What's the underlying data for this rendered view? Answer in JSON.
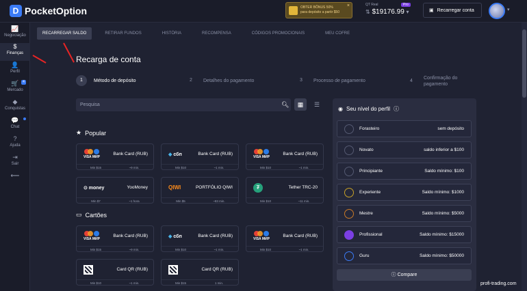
{
  "header": {
    "logo": "PocketOption",
    "bonus_line1": "OBTER BÔNUS 50%",
    "bonus_line2": "para depósito a partir $50",
    "bonus_close": "×",
    "balance_label": "QT Real",
    "balance_badge": "Pro",
    "balance": "$19176.99",
    "recharge_button": "Recarregar conta",
    "brand_color": "#3b7bf6"
  },
  "sidebar": {
    "items": [
      {
        "icon": "chart-icon",
        "glyph": "📈",
        "label": "Negociação"
      },
      {
        "icon": "dollar-icon",
        "glyph": "$",
        "label": "Finanças"
      },
      {
        "icon": "user-icon",
        "glyph": "👤",
        "label": "Perfil"
      },
      {
        "icon": "cart-icon",
        "glyph": "🛒",
        "label": "Mercado",
        "badge": "4"
      },
      {
        "icon": "diamond-icon",
        "glyph": "◆",
        "label": "Conquistas"
      },
      {
        "icon": "chat-icon",
        "glyph": "💬",
        "label": "Chat"
      },
      {
        "icon": "help-icon",
        "glyph": "?",
        "label": "Ajuda"
      },
      {
        "icon": "logout-icon",
        "glyph": "⇥",
        "label": "Sair"
      },
      {
        "icon": "collapse-icon",
        "glyph": "⟵",
        "label": ""
      }
    ]
  },
  "tabs": [
    "RECARREGAR SALDO",
    "RETIRAR FUNDOS",
    "HISTÓRIA",
    "RECOMPENSA",
    "CÓDIGOS PROMOCIONAIS",
    "MEU COFRE"
  ],
  "page_title": "Recarga de conta",
  "steps": [
    {
      "num": "1",
      "label": "Método de depósito"
    },
    {
      "num": "2",
      "label": "Detalhes do pagamento"
    },
    {
      "num": "3",
      "label": "Processo de pagamento"
    },
    {
      "num": "4",
      "label": "Confirmação do pagamento"
    }
  ],
  "search": {
    "placeholder": "Pesquisa"
  },
  "sections": {
    "popular": "Popular",
    "cards": "Cartões"
  },
  "popular": [
    {
      "name": "Bank Card (RUB)",
      "logo": "visa-mir",
      "min": "Min $15",
      "time": "~9 min."
    },
    {
      "name": "Bank Card (RUB)",
      "logo": "sbp",
      "min": "Min $10",
      "time": "~1 min."
    },
    {
      "name": "Bank Card (RUB)",
      "logo": "visa-mir",
      "min": "Min $10",
      "time": "~1 min."
    },
    {
      "name": "YooMoney",
      "logo": "yoomoney",
      "min": "Min $7",
      "time": "~1 hora"
    },
    {
      "name": "PORTFÓLIO QIWI",
      "logo": "qiwi",
      "min": "Min $5",
      "time": "~83 min."
    },
    {
      "name": "Tether TRC-20",
      "logo": "tether",
      "min": "Min $10",
      "time": "~11 min."
    }
  ],
  "cards": [
    {
      "name": "Bank Card (RUB)",
      "logo": "visa-mir",
      "min": "Min $15",
      "time": "~9 min."
    },
    {
      "name": "Bank Card (RUB)",
      "logo": "sbp",
      "min": "Min $10",
      "time": "~1 min."
    },
    {
      "name": "Bank Card (RUB)",
      "logo": "visa-mir",
      "min": "Min $10",
      "time": "~1 min."
    },
    {
      "name": "Card QR (RUB)",
      "logo": "qr",
      "min": "Min $10",
      "time": "~1 min."
    },
    {
      "name": "Card QR (RUB)",
      "logo": "qr",
      "min": "Min $15",
      "time": "1 min."
    }
  ],
  "panel": {
    "title": "Seu nível do perfil",
    "compare": "Compare",
    "levels": [
      {
        "name": "Forasteiro",
        "req": "sem depósito",
        "color": "#555a72"
      },
      {
        "name": "Novato",
        "req": "saldo inferior a $100",
        "color": "#555a72"
      },
      {
        "name": "Principiante",
        "req": "Saldo mínimo: $100",
        "color": "#555a72"
      },
      {
        "name": "Experiente",
        "req": "Saldo mínimo: $1000",
        "color": "#c9a227"
      },
      {
        "name": "Mestre",
        "req": "Saldo mínimo: $5000",
        "color": "#c97a27"
      },
      {
        "name": "Profissional",
        "req": "Saldo mínimo: $15000",
        "color": "#7b3fe4"
      },
      {
        "name": "Guru",
        "req": "Saldo mínimo: $50000",
        "color": "#3b7bf6"
      }
    ]
  },
  "watermark": "profi-trading.com"
}
